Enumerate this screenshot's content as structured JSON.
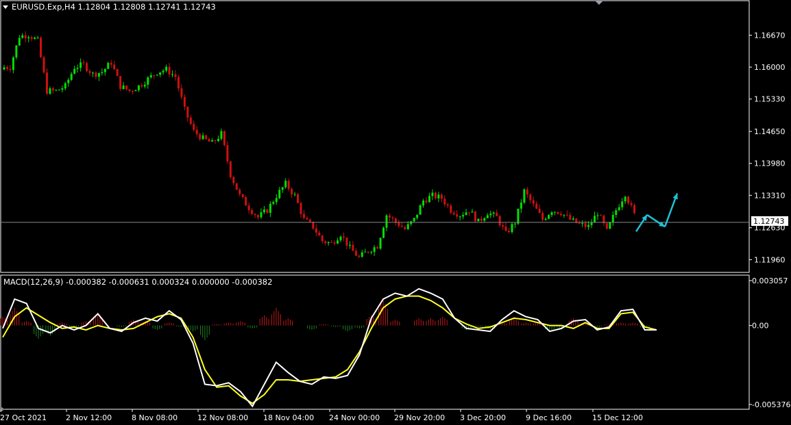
{
  "header": {
    "symbol_line": "EURUSD.Exp,H4  1.12804 1.12808 1.12741 1.12743",
    "macd_line": "MACD(12,26,9) -0.000382 -0.000631 0.000324 0.000000 -0.000382"
  },
  "colors": {
    "background": "#000000",
    "bull": "#00e000",
    "bear": "#d01010",
    "grid_border": "#ffffff",
    "bid_line": "#8a8a8a",
    "arrow": "#20c0d8",
    "macd_line": "#ffffff",
    "signal_line": "#ffff20",
    "hist_up": "#c01818",
    "hist_down": "#208020"
  },
  "icons": [
    "dropdown-triangle-icon",
    "chart-scroll-shift-icon"
  ],
  "current_price_label": "1.12743",
  "chart_data": [
    {
      "type": "candlestick",
      "title": "EURUSD.Exp,H4",
      "ylim": [
        1.1175,
        1.1715
      ],
      "y_ticks": [
        "1.16670",
        "1.16000",
        "1.15330",
        "1.14650",
        "1.13980",
        "1.13310",
        "1.12630",
        "1.11960"
      ],
      "x_ticks": [
        "27 Oct 2021",
        "2 Nov 12:00",
        "8 Nov 08:00",
        "12 Nov 08:00",
        "18 Nov 04:00",
        "24 Nov 00:00",
        "29 Nov 20:00",
        "3 Dec 20:00",
        "9 Dec 16:00",
        "15 Dec 12:00"
      ],
      "current_price": 1.12743,
      "closes": [
        1.16,
        1.1665,
        1.1668,
        1.1655,
        1.155,
        1.155,
        1.156,
        1.16,
        1.1605,
        1.1585,
        1.159,
        1.161,
        1.156,
        1.155,
        1.156,
        1.1575,
        1.159,
        1.1595,
        1.158,
        1.151,
        1.1465,
        1.145,
        1.144,
        1.146,
        1.1375,
        1.133,
        1.1305,
        1.1285,
        1.13,
        1.133,
        1.1355,
        1.133,
        1.128,
        1.1265,
        1.1235,
        1.123,
        1.125,
        1.122,
        1.12,
        1.1215,
        1.1225,
        1.129,
        1.1275,
        1.126,
        1.128,
        1.132,
        1.133,
        1.1325,
        1.13,
        1.129,
        1.13,
        1.1275,
        1.1295,
        1.1285,
        1.125,
        1.1275,
        1.134,
        1.131,
        1.128,
        1.13,
        1.1295,
        1.128,
        1.127,
        1.1265,
        1.1295,
        1.1255,
        1.13,
        1.1335,
        1.129
      ],
      "arrows": [
        [
          1.1255,
          1.129
        ],
        [
          1.129,
          1.1265
        ],
        [
          1.1265,
          1.1335
        ]
      ]
    },
    {
      "type": "macd",
      "title": "MACD(12,26,9)",
      "ylim": [
        -0.005376,
        0.003057
      ],
      "y_ticks": [
        "0.003057",
        "0.00",
        "-0.005376"
      ],
      "macd": [
        -0.0002,
        0.0018,
        0.0015,
        -0.0002,
        -0.0005,
        0.0,
        -0.0003,
        0.0,
        0.0008,
        -0.0002,
        -0.0004,
        0.0002,
        0.0005,
        0.0003,
        0.001,
        0.0004,
        -0.0012,
        -0.004,
        -0.0041,
        -0.0039,
        -0.0045,
        -0.0055,
        -0.004,
        -0.0025,
        -0.0032,
        -0.0038,
        -0.004,
        -0.0035,
        -0.0036,
        -0.0034,
        -0.002,
        0.0005,
        0.0018,
        0.0022,
        0.002,
        0.0025,
        0.0022,
        0.0018,
        0.0005,
        -0.0002,
        -0.0003,
        -0.0004,
        0.0004,
        0.001,
        0.0006,
        0.0004,
        -0.0004,
        -0.0002,
        0.0003,
        0.0004,
        -0.0003,
        -0.0001,
        0.001,
        0.0011,
        -0.0003,
        -0.0003
      ],
      "signal": [
        -0.0008,
        0.0006,
        0.0012,
        0.0007,
        0.0002,
        -0.0002,
        -0.0001,
        -0.0003,
        0.0,
        -0.0002,
        -0.0003,
        -0.0002,
        0.0002,
        0.0006,
        0.0008,
        0.0005,
        -0.0008,
        -0.003,
        -0.0042,
        -0.0041,
        -0.0048,
        -0.0053,
        -0.0047,
        -0.0037,
        -0.0037,
        -0.0038,
        -0.0037,
        -0.0036,
        -0.0035,
        -0.003,
        -0.0018,
        -0.0002,
        0.0012,
        0.0018,
        0.002,
        0.002,
        0.0017,
        0.0012,
        0.0005,
        0.0001,
        -0.0002,
        -0.0001,
        0.0002,
        0.0005,
        0.0004,
        0.0002,
        0.0,
        0.0,
        -0.0002,
        0.0002,
        -0.0002,
        -0.0002,
        0.0008,
        0.0009,
        -0.0001,
        -0.0003
      ],
      "histogram": [
        0.0006,
        0.0012,
        0.0003,
        -0.0009,
        -0.0007,
        0.0002,
        -0.0002,
        0.0003,
        0.0008,
        0.0,
        -0.0001,
        0.0004,
        0.0003,
        -0.0003,
        0.0002,
        -0.0001,
        -0.0004,
        -0.001,
        0.0001,
        0.0002,
        0.0003,
        -0.0002,
        0.0007,
        0.0012,
        0.0005,
        0.0,
        -0.0003,
        0.0001,
        -0.0001,
        -0.0004,
        -0.0002,
        0.0007,
        0.0018,
        0.0004,
        0.0,
        0.0005,
        0.0005,
        0.0006,
        0.0,
        -0.0003,
        -0.0001,
        -0.0003,
        0.0002,
        0.0005,
        0.0002,
        0.0002,
        -0.0004,
        -0.0002,
        0.0005,
        0.0002,
        -0.0001,
        0.0001,
        0.0002,
        0.0002,
        -0.0002,
        0.0
      ]
    }
  ]
}
